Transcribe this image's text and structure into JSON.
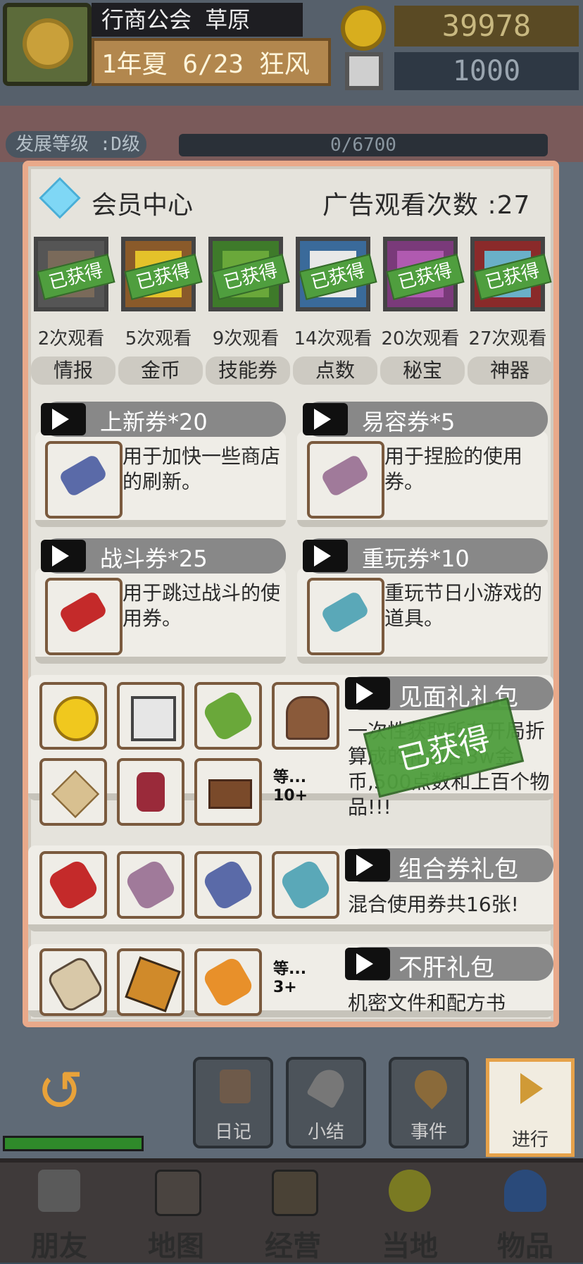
{
  "header": {
    "location": "行商公会 草原",
    "date": "1年夏 6/23 狂风",
    "gold": "39978",
    "silver": "1000",
    "level": "发展等级 :D级",
    "progress": "0/6700"
  },
  "vip": {
    "title": "会员中心",
    "ad_count": "广告观看次数 :27",
    "rewards": [
      {
        "count": "2次观看",
        "tag": "情报",
        "stamp": "已获得",
        "frame": "#555555",
        "fill": "#7a6a5a"
      },
      {
        "count": "5次观看",
        "tag": "金币",
        "stamp": "已获得",
        "frame": "#8a5a2a",
        "fill": "#e4c22a"
      },
      {
        "count": "9次观看",
        "tag": "技能券",
        "stamp": "已获得",
        "frame": "#3e7a2a",
        "fill": "#6aa83a"
      },
      {
        "count": "14次观看",
        "tag": "点数",
        "stamp": "已获得",
        "frame": "#3a6a9a",
        "fill": "#e8e8e8"
      },
      {
        "count": "20次观看",
        "tag": "秘宝",
        "stamp": "已获得",
        "frame": "#7a3a7a",
        "fill": "#b05ab0"
      },
      {
        "count": "27次观看",
        "tag": "神器",
        "stamp": "已获得",
        "frame": "#8a2a2a",
        "fill": "#6ab0c8"
      }
    ]
  },
  "coupons": [
    {
      "title": "上新券*20",
      "desc": "用于加快一些商店的刷新。",
      "color": "#5a6aa8"
    },
    {
      "title": "易容券*5",
      "desc": "用于捏脸的使用券。",
      "color": "#a07a9a"
    },
    {
      "title": "战斗券*25",
      "desc": "用于跳过战斗的使用券。",
      "color": "#c42a2a"
    },
    {
      "title": "重玩券*10",
      "desc": "重玩节日小游戏的道具。",
      "color": "#5aa8b8"
    }
  ],
  "packs": {
    "welcome": {
      "title": "见面礼礼包",
      "desc": "一次性获取所有开局折算成的礼包含3w金币,500点数和上百个物品!!!",
      "more": "等...",
      "more_count": "10+",
      "stamp": "已获得",
      "icons": [
        "gold-coin-icon",
        "silver-point-icon",
        "skill-scroll-icon",
        "treasure-chest-icon",
        "compass-icon",
        "potion-bottle-icon",
        "brick-icon"
      ]
    },
    "combo": {
      "title": "组合券礼包",
      "desc": "混合使用券共16张!"
    },
    "easy": {
      "title": "不肝礼包",
      "desc": "机密文件和配方书",
      "more": "等...",
      "more_count": "3+"
    }
  },
  "actions": [
    {
      "label": "日记"
    },
    {
      "label": "小结"
    },
    {
      "label": "事件"
    },
    {
      "label": "进行"
    }
  ],
  "nav": [
    {
      "label": "朋友"
    },
    {
      "label": "地图"
    },
    {
      "label": "经营"
    },
    {
      "label": "当地"
    },
    {
      "label": "物品"
    }
  ]
}
